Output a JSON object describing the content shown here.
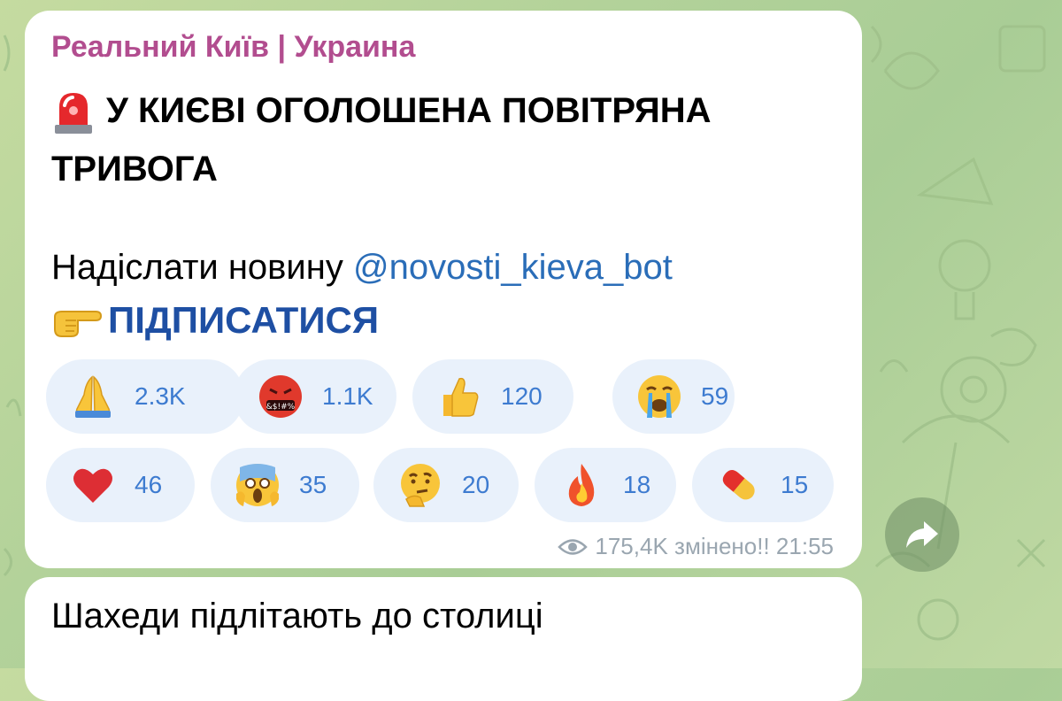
{
  "message": {
    "channel_name": "Реальний Київ | Украина",
    "headline": "У КИЄВІ ОГОЛОШЕНА ПОВІТРЯНА ТРИВОГА",
    "submit_text": "Надіслати новину ",
    "bot_mention": "@novosti_kieva_bot",
    "subscribe_label": "ПІДПИСАТИСЯ",
    "reactions": [
      {
        "emoji": "praying-hands",
        "count": "2.3K"
      },
      {
        "emoji": "face-with-symbols",
        "count": "1.1K"
      },
      {
        "emoji": "thumbs-up",
        "count": "120"
      },
      {
        "emoji": "loudly-crying-face",
        "count": "59"
      },
      {
        "emoji": "red-heart",
        "count": "46"
      },
      {
        "emoji": "screaming-face",
        "count": "35"
      },
      {
        "emoji": "thinking-face",
        "count": "20"
      },
      {
        "emoji": "fire",
        "count": "18"
      },
      {
        "emoji": "pill",
        "count": "15"
      }
    ],
    "views": "175,4K",
    "edited_label": "змінено!!",
    "time": "21:55"
  },
  "next_message": {
    "text": "Шахеди підлітають до столиці"
  },
  "colors": {
    "channel_name": "#b24d8f",
    "mention": "#2a6db8",
    "subscribe": "#1e4fa3",
    "reaction_bg": "#e9f1fb",
    "reaction_count": "#3d7bd0",
    "meta": "#9aa6b0"
  }
}
